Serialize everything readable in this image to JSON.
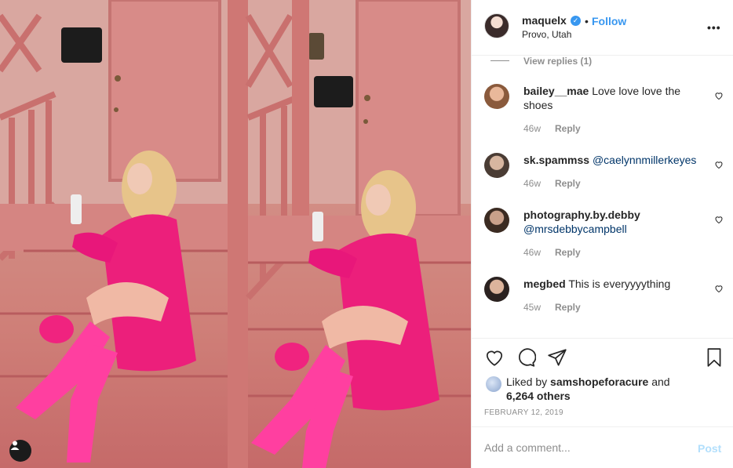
{
  "post": {
    "username": "maquelx",
    "verified_icon": "verified-badge-icon",
    "separator": "•",
    "follow_label": "Follow",
    "location": "Provo, Utah",
    "more_label": "•••"
  },
  "comments": {
    "view_replies": "View replies (1)",
    "items": [
      {
        "username": "bailey__mae",
        "text": "Love love love the shoes",
        "mention": "",
        "age": "46w",
        "reply_label": "Reply"
      },
      {
        "username": "sk.spammss",
        "text": "",
        "mention": "@caelynnmillerkeyes",
        "age": "46w",
        "reply_label": "Reply"
      },
      {
        "username": "photography.by.debby",
        "text": "",
        "mention": "@mrsdebbycampbell",
        "age": "46w",
        "reply_label": "Reply"
      },
      {
        "username": "megbed",
        "text": "This is everyyyything",
        "mention": "",
        "age": "45w",
        "reply_label": "Reply"
      }
    ]
  },
  "likes": {
    "prefix": "Liked by",
    "user": "samshopeforacure",
    "and": "and",
    "others": "6,264 others"
  },
  "date": "FEBRUARY 12, 2019",
  "add_comment": {
    "placeholder": "Add a comment...",
    "post_label": "Post"
  },
  "colors": {
    "accent": "#3897f0",
    "post_disabled": "#b2dffc",
    "muted": "#8e8e8e",
    "mention": "#003569"
  }
}
